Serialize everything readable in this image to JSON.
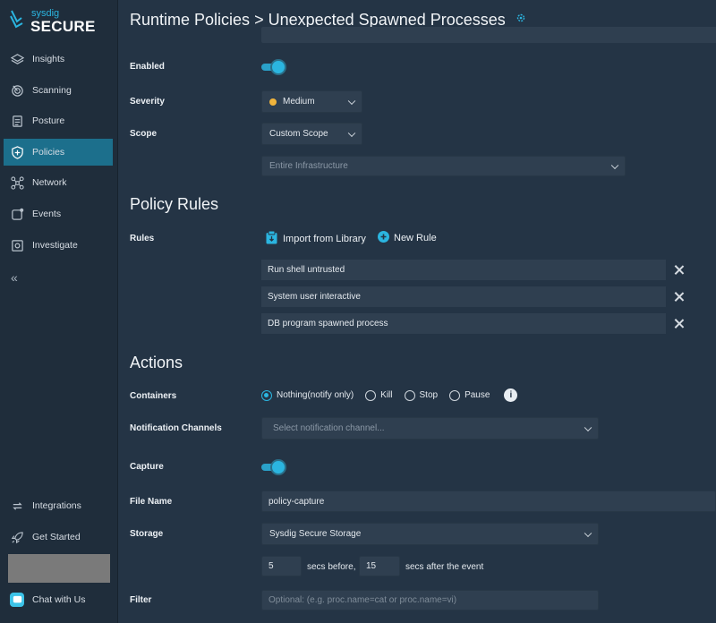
{
  "brand": {
    "line1": "sysdig",
    "line2": "SECURE"
  },
  "sidebar": {
    "items": [
      {
        "label": "Insights",
        "icon": "layers-icon"
      },
      {
        "label": "Scanning",
        "icon": "scan-icon"
      },
      {
        "label": "Posture",
        "icon": "clipboard-icon"
      },
      {
        "label": "Policies",
        "icon": "shield-icon",
        "active": true
      },
      {
        "label": "Network",
        "icon": "network-icon"
      },
      {
        "label": "Events",
        "icon": "events-icon"
      },
      {
        "label": "Investigate",
        "icon": "investigate-icon"
      }
    ],
    "collapse": "«",
    "bottom": [
      {
        "label": "Integrations",
        "icon": "sync-icon"
      },
      {
        "label": "Get Started",
        "icon": "rocket-icon"
      }
    ],
    "chat": "Chat with Us"
  },
  "header": {
    "breadcrumb_parent": "Runtime Policies",
    "separator": ">",
    "title": "Unexpected Spawned Processes"
  },
  "form": {
    "enabled_label": "Enabled",
    "enabled": true,
    "severity_label": "Severity",
    "severity_value": "Medium",
    "severity_color": "#f0b43c",
    "scope_label": "Scope",
    "scope_value": "Custom Scope",
    "scope_infra": "Entire Infrastructure"
  },
  "policy_rules": {
    "heading": "Policy Rules",
    "rules_label": "Rules",
    "import_label": "Import from Library",
    "new_rule_label": "New Rule",
    "rules": [
      "Run shell untrusted",
      "System user interactive",
      "DB program spawned process"
    ]
  },
  "actions": {
    "heading": "Actions",
    "containers_label": "Containers",
    "container_options": [
      "Nothing(notify only)",
      "Kill",
      "Stop",
      "Pause"
    ],
    "container_selected": "Nothing(notify only)",
    "info": "i",
    "notification_label": "Notification Channels",
    "notification_placeholder": "Select notification channel...",
    "capture_label": "Capture",
    "capture_enabled": true,
    "file_name_label": "File Name",
    "file_name_value": "policy-capture",
    "storage_label": "Storage",
    "storage_value": "Sysdig Secure Storage",
    "secs_before_value": "5",
    "secs_before_text": "secs before,",
    "secs_after_value": "15",
    "secs_after_text": "secs after the event",
    "filter_label": "Filter",
    "filter_placeholder": "Optional: (e.g. proc.name=cat or proc.name=vi)"
  },
  "colors": {
    "accent": "#2bb5e0",
    "sidebar_active": "#1c6f8c",
    "background": "#243445"
  }
}
